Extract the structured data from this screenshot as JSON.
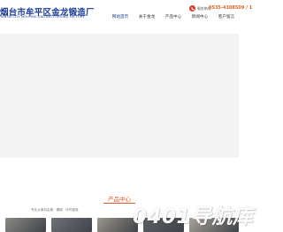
{
  "header": {
    "logo_cn": "烟台市牟平区金龙锻造厂",
    "logo_en": "YANTAI CITY MOUPING JINLONG FORGING FACTORY",
    "phone_label": "服务热线：",
    "phone_number": "0535-4308509 / 1"
  },
  "nav": {
    "items": [
      {
        "label": "网站首页"
      },
      {
        "label": "关于金龙"
      },
      {
        "label": "产品中心"
      },
      {
        "label": "新闻中心"
      },
      {
        "label": "客户留言"
      }
    ]
  },
  "products": {
    "title": "产品中心",
    "category_text": "专业从事自由锻 · 模锻 · 环件锻造",
    "tiles": [
      {
        "color": "#8a8a86"
      },
      {
        "color": "#6f7378"
      },
      {
        "color": "#9b958c"
      },
      {
        "color": "#5c5f64"
      },
      {
        "color": "#a7a29a"
      }
    ]
  },
  "watermark": {
    "text": "0401导航库"
  },
  "colors": {
    "brand_blue": "#1b3d8f",
    "accent_orange": "#e0592c",
    "phone_red": "#d23b2e"
  }
}
